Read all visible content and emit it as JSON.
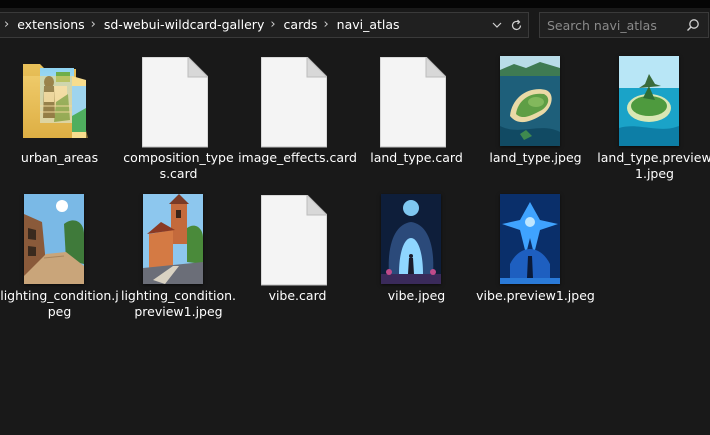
{
  "address_bar": {
    "breadcrumbs": [
      "extensions",
      "sd-webui-wildcard-gallery",
      "cards",
      "navi_atlas"
    ]
  },
  "search": {
    "placeholder": "Search navi_atlas"
  },
  "items": [
    {
      "name": "urban_areas",
      "type": "folder"
    },
    {
      "name": "composition_types.card",
      "type": "file"
    },
    {
      "name": "image_effects.card",
      "type": "file"
    },
    {
      "name": "land_type.card",
      "type": "file"
    },
    {
      "name": "land_type.jpeg",
      "type": "image"
    },
    {
      "name": "land_type.preview1.jpeg",
      "type": "image"
    },
    {
      "name": "lighting_condition.jpeg",
      "type": "image"
    },
    {
      "name": "lighting_condition.preview1.jpeg",
      "type": "image"
    },
    {
      "name": "vibe.card",
      "type": "file"
    },
    {
      "name": "vibe.jpeg",
      "type": "image"
    },
    {
      "name": "vibe.preview1.jpeg",
      "type": "image"
    }
  ]
}
